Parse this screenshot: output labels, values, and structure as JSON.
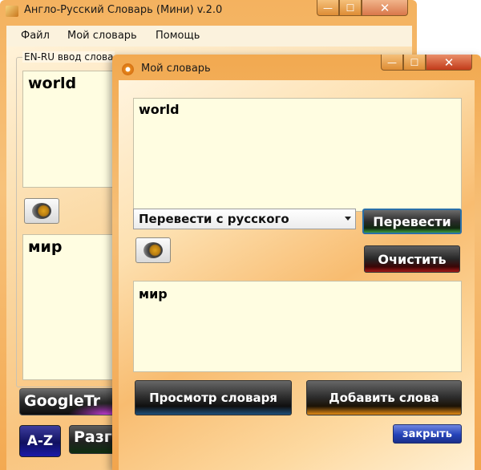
{
  "main_window": {
    "title": "Англо-Русский Словарь (Мини) v.2.0",
    "controls": {
      "minimize": "—",
      "maximize": "☐",
      "close": "✕"
    },
    "menu": [
      "Файл",
      "Мой словарь",
      "Помощь"
    ],
    "group_label": "EN-RU ввод слова",
    "source_text": "world",
    "result_text": "мир",
    "buttons": {
      "google": "GoogleTr",
      "az": "A-Z",
      "razg": "Разг"
    }
  },
  "dictionary_window": {
    "title": "Мой словарь",
    "controls": {
      "minimize": "—",
      "maximize": "☐",
      "close": "✕"
    },
    "input_text": "world",
    "direction_select": "Перевести с  русского",
    "translate_button": "Перевести",
    "clear_button": "Очистить",
    "output_text": "мир",
    "view_dictionary_button": "Просмотр словаря",
    "add_words_button": "Добавить слова",
    "close_button": "закрыть"
  },
  "icons": [
    "app-icon",
    "speaker-icon",
    "dictionary-icon"
  ]
}
